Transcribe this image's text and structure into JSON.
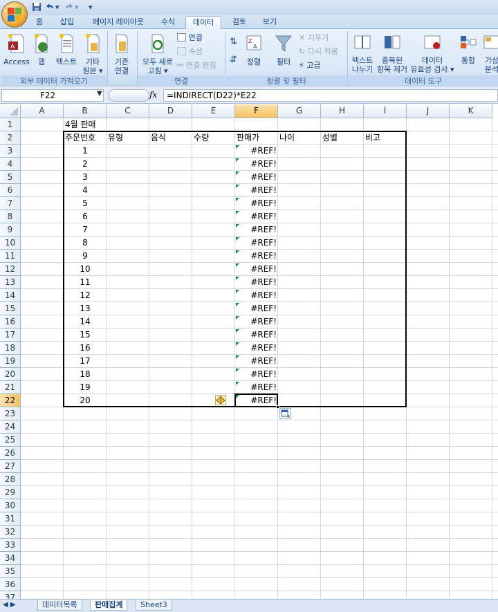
{
  "title_bar": {
    "quick_access": [
      "save-icon",
      "undo-icon",
      "redo-icon",
      "customize-icon"
    ]
  },
  "tabs": [
    {
      "label": "홈",
      "active": false
    },
    {
      "label": "삽입",
      "active": false
    },
    {
      "label": "페이지 레이아웃",
      "active": false
    },
    {
      "label": "수식",
      "active": false
    },
    {
      "label": "데이터",
      "active": true
    },
    {
      "label": "검토",
      "active": false
    },
    {
      "label": "보기",
      "active": false
    }
  ],
  "ribbon": {
    "external": {
      "access": "Access",
      "web": "웹",
      "text": "텍스트",
      "other1": "기타",
      "other2": "원본",
      "label": "외부 데이터 가져오기"
    },
    "existing": {
      "line1": "기존",
      "line2": "연결"
    },
    "connections": {
      "refresh1": "모두 새로",
      "refresh2": "고침",
      "conn": "연결",
      "props": "속성",
      "edit": "연결 편집",
      "label": "연결"
    },
    "sort": {
      "sort": "정렬",
      "filter": "필터",
      "clear": "지우기",
      "reapply": "다시 적용",
      "advanced": "고급",
      "label": "정렬 및 필터"
    },
    "tools": {
      "t2c1": "텍스트",
      "t2c2": "나누기",
      "dup1": "중복된",
      "dup2": "항목 제거",
      "val1": "데이터",
      "val2": "유효성 검사",
      "consolidate": "통합",
      "whatif1": "가상",
      "whatif2": "분석",
      "label": "데이터 도구"
    }
  },
  "formula_bar": {
    "name_box": "F22",
    "fx": "fx",
    "formula": "=INDIRECT(D22)*E22"
  },
  "sheet": {
    "columns": [
      "A",
      "B",
      "C",
      "D",
      "E",
      "F",
      "G",
      "H",
      "I",
      "J",
      "K"
    ],
    "selected_column": "F",
    "selected_row": 22,
    "rows_visible": 37,
    "title_cell": "4월 판매",
    "headers": [
      "주문번호",
      "유형",
      "음식",
      "수량",
      "판매가",
      "나이",
      "성별",
      "비고"
    ],
    "order_numbers": [
      1,
      2,
      3,
      4,
      5,
      6,
      7,
      8,
      9,
      10,
      11,
      12,
      13,
      14,
      15,
      16,
      17,
      18,
      19,
      20
    ],
    "price_value": "#REF!"
  },
  "sheet_tabs": [
    "데이터목록",
    "판매집계",
    "Sheet3"
  ]
}
